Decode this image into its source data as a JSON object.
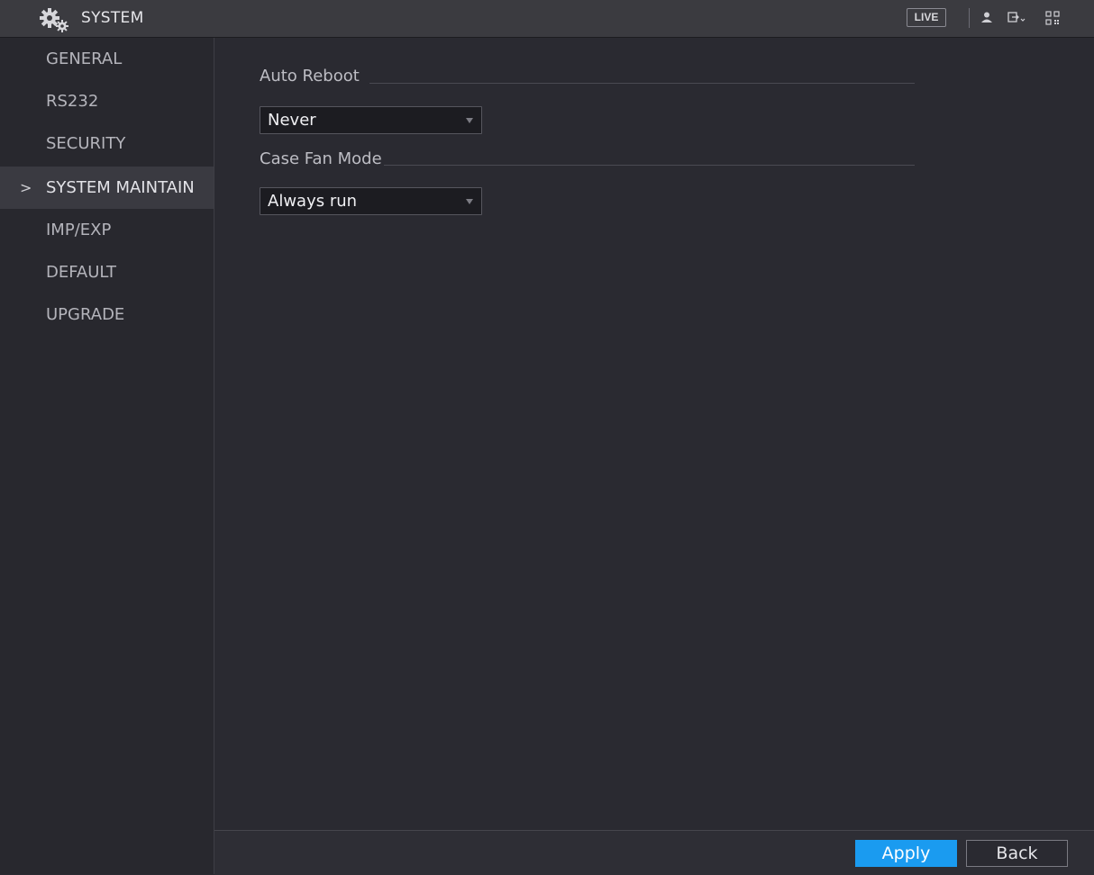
{
  "header": {
    "title": "SYSTEM",
    "app_icon": "gears-icon",
    "live_label": "LIVE",
    "icons": [
      "user-icon",
      "logout-icon",
      "qr-code-icon"
    ]
  },
  "sidebar": {
    "items": [
      {
        "label": "GENERAL",
        "active": false
      },
      {
        "label": "RS232",
        "active": false
      },
      {
        "label": "SECURITY",
        "active": false
      },
      {
        "label": "SYSTEM MAINTAIN",
        "active": true
      },
      {
        "label": "IMP/EXP",
        "active": false
      },
      {
        "label": "DEFAULT",
        "active": false
      },
      {
        "label": "UPGRADE",
        "active": false
      }
    ],
    "active_indicator": ">"
  },
  "main": {
    "auto_reboot": {
      "label": "Auto Reboot",
      "value": "Never"
    },
    "case_fan_mode": {
      "label": "Case Fan Mode",
      "value": "Always run"
    }
  },
  "footer": {
    "apply_label": "Apply",
    "back_label": "Back"
  },
  "colors": {
    "accent": "#1a9bf0",
    "background": "#2a2a31",
    "topbar": "#3b3b40"
  }
}
